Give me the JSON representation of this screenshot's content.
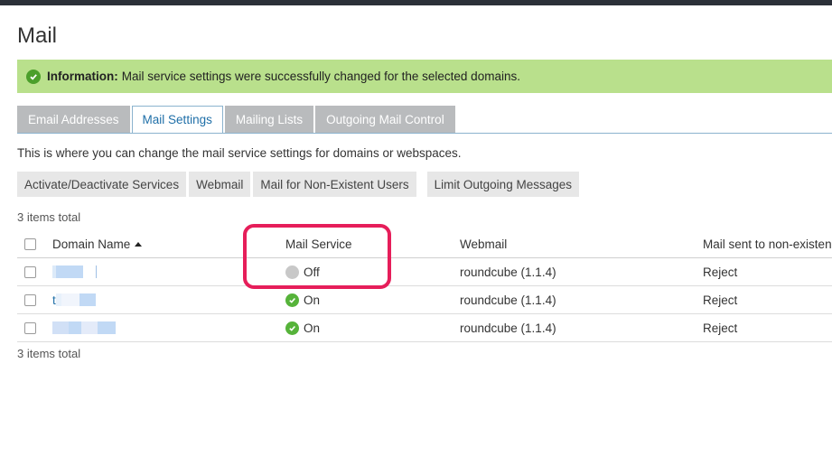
{
  "page": {
    "title": "Mail"
  },
  "info": {
    "label": "Information:",
    "message": "Mail service settings were successfully changed for the selected domains."
  },
  "tabs": [
    {
      "label": "Email Addresses"
    },
    {
      "label": "Mail Settings"
    },
    {
      "label": "Mailing Lists"
    },
    {
      "label": "Outgoing Mail Control"
    }
  ],
  "description": "This is where you can change the mail service settings for domains or webspaces.",
  "toolbar": [
    {
      "label": "Activate/Deactivate Services"
    },
    {
      "label": "Webmail"
    },
    {
      "label": "Mail for Non-Existent Users"
    },
    {
      "label": "Limit Outgoing Messages"
    }
  ],
  "items_total": "3 items total",
  "table": {
    "headers": {
      "domain": "Domain Name",
      "mail_service": "Mail Service",
      "webmail": "Webmail",
      "nonexistent": "Mail sent to non-existen"
    },
    "rows": [
      {
        "domain": "",
        "mail_service": "Off",
        "mail_icon": "status-off-icon",
        "webmail": "roundcube (1.1.4)",
        "nonexistent": "Reject"
      },
      {
        "domain": "t",
        "mail_service": "On",
        "mail_icon": "check-circle-icon",
        "webmail": "roundcube (1.1.4)",
        "nonexistent": "Reject"
      },
      {
        "domain": "",
        "mail_service": "On",
        "mail_icon": "check-circle-icon",
        "webmail": "roundcube (1.1.4)",
        "nonexistent": "Reject"
      }
    ]
  },
  "colors": {
    "success": "#56b33a",
    "highlight": "#e61e5a",
    "info_bg": "#b9e08c",
    "link": "#1f6fa8"
  }
}
